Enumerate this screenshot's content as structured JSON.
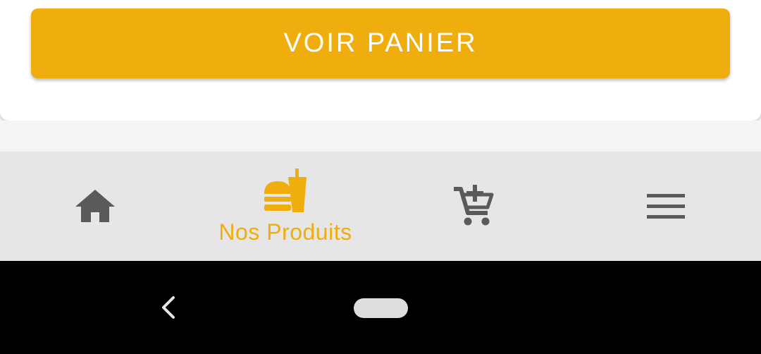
{
  "cart_button": {
    "label": "VOIR PANIER"
  },
  "bottom_nav": {
    "items": [
      {
        "icon": "home-icon",
        "label": "",
        "active": false
      },
      {
        "icon": "burger-drink-icon",
        "label": "Nos Produits",
        "active": true
      },
      {
        "icon": "add-to-cart-icon",
        "label": "",
        "active": false
      },
      {
        "icon": "menu-icon",
        "label": "",
        "active": false
      }
    ]
  },
  "colors": {
    "accent": "#f0ad0e",
    "inactive_icon": "#5a5a5a",
    "nav_background": "#e6e6e6",
    "system_bar": "#000000"
  }
}
